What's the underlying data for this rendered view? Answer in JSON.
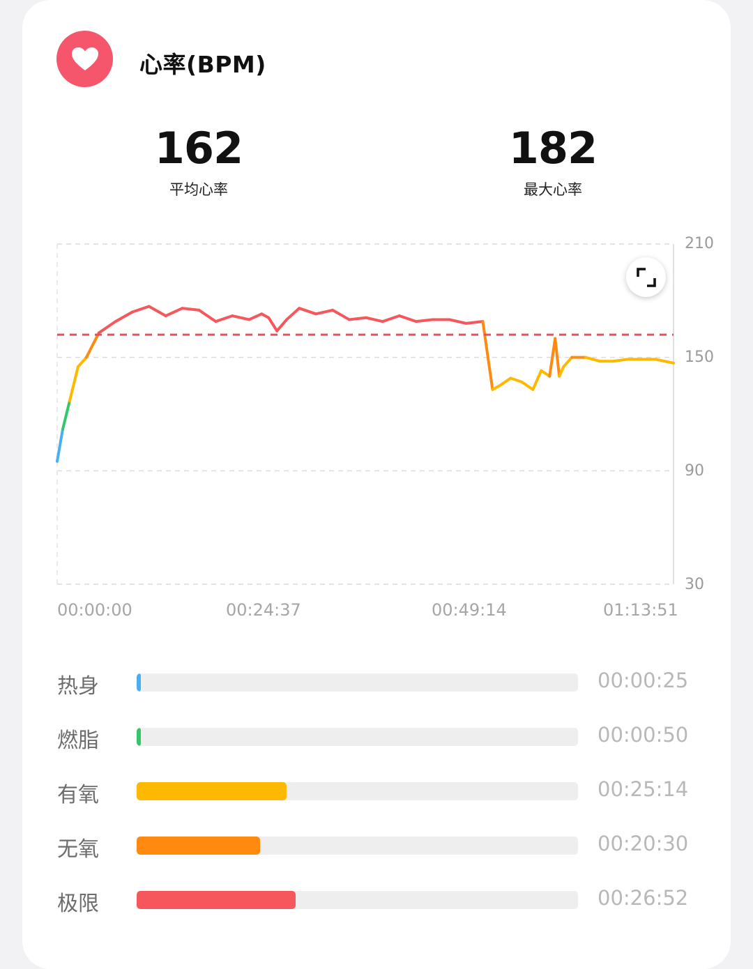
{
  "header": {
    "title": "心率(BPM)",
    "icon": "heart-icon",
    "accent": "#f5566b"
  },
  "stats": [
    {
      "value": "162",
      "label": "平均心率"
    },
    {
      "value": "182",
      "label": "最大心率"
    }
  ],
  "controls": {
    "expand_icon": "expand-icon"
  },
  "chart_data": {
    "type": "line",
    "x_tick_labels": [
      "00:00:00",
      "00:24:37",
      "00:49:14",
      "01:13:51"
    ],
    "y_ticks": [
      210,
      150,
      90,
      30
    ],
    "ylim": [
      30,
      210
    ],
    "xlim_seconds": [
      0,
      4431
    ],
    "grid": true,
    "reference_line": {
      "value": 162,
      "style": "dashed",
      "color": "#e8505b"
    },
    "zone_colors": {
      "warmup": "#4aaef5",
      "fatburn": "#34c76a",
      "aerobic": "#fdb900",
      "anaerobic": "#ff8a0f",
      "extreme": "#f5575d"
    },
    "series": [
      {
        "t": [
          0,
          40,
          90,
          150,
          210,
          300,
          420,
          540,
          660,
          780,
          900,
          1020,
          1140,
          1260,
          1380,
          1470,
          1520,
          1580,
          1650,
          1740,
          1860,
          1980,
          2100,
          2220,
          2340,
          2460,
          2580,
          2700,
          2820,
          2940,
          3060,
          3130,
          3180,
          3260,
          3340,
          3420,
          3480,
          3540,
          3580,
          3610,
          3640,
          3700,
          3800,
          3900,
          4000,
          4100,
          4200,
          4300,
          4431
        ],
        "bpm": [
          95,
          112,
          127,
          145,
          150,
          163,
          169,
          174,
          177,
          172,
          176,
          175,
          169,
          172,
          170,
          173,
          171,
          164,
          170,
          176,
          173,
          175,
          170,
          171,
          169,
          172,
          169,
          170,
          170,
          168,
          169,
          133,
          135,
          139,
          137,
          133,
          143,
          140,
          160,
          140,
          145,
          150,
          150,
          148,
          148,
          149,
          149,
          149,
          147
        ]
      }
    ]
  },
  "zones": [
    {
      "name": "热身",
      "time": "00:00:25",
      "fraction": 0.009,
      "color": "#4aaef5"
    },
    {
      "name": "燃脂",
      "time": "00:00:50",
      "fraction": 0.009,
      "color": "#34c76a"
    },
    {
      "name": "有氧",
      "time": "00:25:14",
      "fraction": 0.34,
      "color": "#fdb900"
    },
    {
      "name": "无氧",
      "time": "00:20:30",
      "fraction": 0.28,
      "color": "#ff8a0f"
    },
    {
      "name": "极限",
      "time": "00:26:52",
      "fraction": 0.36,
      "color": "#f5575d"
    }
  ]
}
